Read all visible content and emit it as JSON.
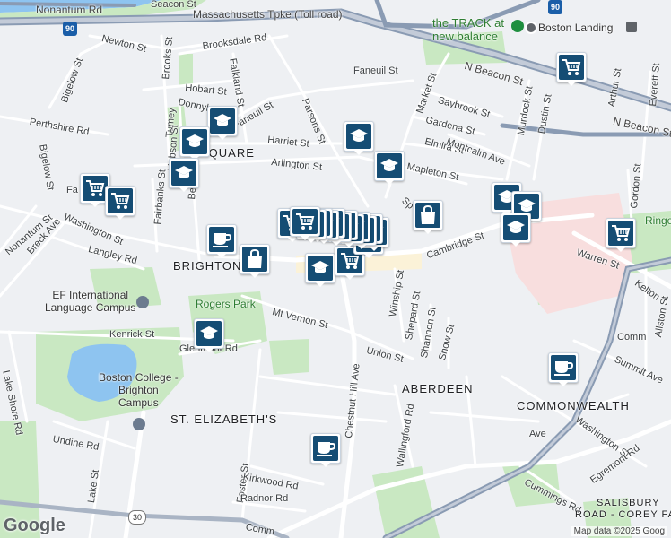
{
  "streets": {
    "nonantum_rd": "Nonantum Rd",
    "mass_pike": "Massachusetts Tpke (Toll road)",
    "seacon_st": "Seacon St",
    "newton_st": "Newton St",
    "brooksdale_rd": "Brooksdale Rd",
    "brooks_st": "Brooks St",
    "falkland_st": "Falkland St",
    "bigelow_st": "Bigelow St",
    "hobart_st": "Hobart St",
    "donnybrook": "Donnybrook",
    "faneuil_st_west": "Faneuil St",
    "perthshire_rd": "Perthshire Rd",
    "tumey": "Tumey",
    "hobson_st": "Hobson St",
    "harriet_st": "Harriet St",
    "parsons_st": "Parsons St",
    "arlington_st": "Arlington St",
    "faneuil_st_east": "Faneuil St",
    "market_st": "Market St",
    "saybrook_st": "Saybrook St",
    "gardena_st": "Gardena St",
    "murdock_st": "Murdock St",
    "dustin_st": "Dustin St",
    "elmira_st": "Elmira St",
    "montcalm_ave": "Montcalm Ave",
    "mapleton_st": "Mapleton St",
    "n_beacon_st": "N Beacon St",
    "n_beacon_st_2": "N Beacon St",
    "everett_st": "Everett St",
    "arthur_st": "Arthur St",
    "gordon_st": "Gordon St",
    "fa_st": "Fa",
    "washington_st_w": "Washington St",
    "fairbanks_st": "Fairbanks St",
    "beechcroft": "Beechc",
    "bigelow_st_2": "Bigelow St",
    "nonantum_st": "Nonantum St",
    "breck_ave": "Breck Ave",
    "langley_rd": "Langley Rd",
    "cambridge_st": "Cambridge St",
    "warren_st": "Warren St",
    "kelton": "Kelton",
    "spark_st": "Sp",
    "winship_st": "Winship St",
    "shepard_st": "Shepard St",
    "shannon_st": "Shannon St",
    "snow_st": "Snow St",
    "mt_vernon_st": "Mt Vernon St",
    "kenrick_st": "Kenrick St",
    "glenmont_rd": "Glenmont Rd",
    "lake_shore_rd": "Lake Shore Rd",
    "union_st": "Union St",
    "chestnut_hill_ave": "Chestnut Hill Ave",
    "allston_st": "Allston St",
    "summit_ave": "Summit Ave",
    "commonwealth": "Comm",
    "washington_st_e": "Washington St",
    "wallingford_rd": "Wallingford Rd",
    "undine_rd": "Undine Rd",
    "lake_st": "Lake St",
    "foster_st": "Foster St",
    "kirkwood_rd": "Kirkwood Rd",
    "radnor_rd": "Radnor Rd",
    "egremont_rd": "Egremont Rd",
    "cummings_rd": "Cummings Rd",
    "comm_bottom": "Comm",
    "ave_fragment": "Ave"
  },
  "areas": {
    "square": "SQUARE",
    "brighton": "BRIGHTON",
    "aberdeen": "ABERDEEN",
    "st_elizabeths": "ST. ELIZABETH'S",
    "commonwealth": "COMMONWEALTH",
    "salisbury_1": "SALISBURY",
    "salisbury_2": "ROAD - COREY FARI"
  },
  "parks": {
    "rogers_park": "Rogers Park",
    "ringer": "Ringe"
  },
  "pois": {
    "the_track_1": "the TRACK at",
    "the_track_2": "new balance",
    "boston_landing": "Boston Landing",
    "ef_1": "EF International",
    "ef_2": "Language Campus",
    "bc_1": "Boston College -",
    "bc_2": "Brighton",
    "bc_3": "Campus"
  },
  "shields": {
    "i90_left": "90",
    "i90_right": "90",
    "route_30": "30"
  },
  "footer": {
    "google": "Google",
    "attribution": "Map data ©2025 Goog"
  },
  "markers": [
    {
      "type": "grocery"
    },
    {
      "type": "school"
    },
    {
      "type": "school"
    },
    {
      "type": "school"
    },
    {
      "type": "grocery"
    },
    {
      "type": "grocery"
    },
    {
      "type": "school"
    },
    {
      "type": "school"
    },
    {
      "type": "school"
    },
    {
      "type": "shopping"
    },
    {
      "type": "school"
    },
    {
      "type": "school"
    },
    {
      "type": "grocery"
    },
    {
      "type": "cafe"
    },
    {
      "type": "shopping"
    },
    {
      "type": "school"
    },
    {
      "type": "grocery"
    },
    {
      "type": "school"
    },
    {
      "type": "cafe"
    },
    {
      "type": "cafe"
    },
    {
      "type": "shopping"
    },
    {
      "type": "grocery"
    }
  ],
  "colors": {
    "marker_fill": "#154d74",
    "park": "#c9e8c2",
    "water": "#8ec4f0",
    "highway": "#8a9bb3",
    "hospital": "#f8dede",
    "commercial": "#fbf2d8"
  }
}
